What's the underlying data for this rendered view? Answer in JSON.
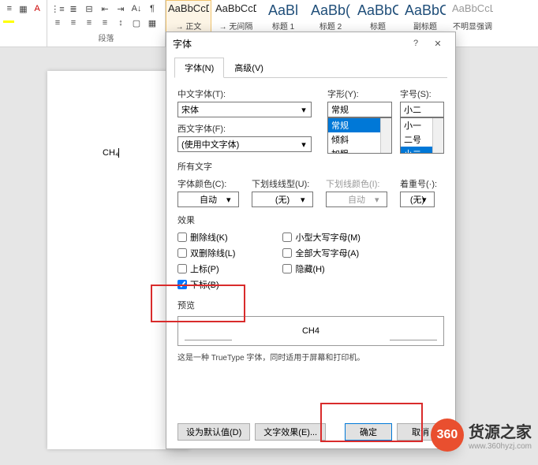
{
  "ribbon": {
    "paragraph_label": "段落",
    "styles": [
      {
        "preview": "AaBbCcDc",
        "name": "→ 正文",
        "cls": "small"
      },
      {
        "preview": "AaBbCcDc",
        "name": "→ 无间隔",
        "cls": "small"
      },
      {
        "preview": "AaBl",
        "name": "标题 1",
        "cls": "big"
      },
      {
        "preview": "AaBb(",
        "name": "标题 2",
        "cls": "big"
      },
      {
        "preview": "AaBbC",
        "name": "标题",
        "cls": "big"
      },
      {
        "preview": "AaBbC",
        "name": "副标题",
        "cls": "big"
      },
      {
        "preview": "AaBbCcL",
        "name": "不明显强调",
        "cls": "gray"
      }
    ]
  },
  "doc": {
    "text": "CH₄"
  },
  "dialog": {
    "title": "字体",
    "tabs": {
      "font": "字体(N)",
      "advanced": "高级(V)"
    },
    "cn_font_label": "中文字体(T):",
    "cn_font_value": "宋体",
    "en_font_label": "西文字体(F):",
    "en_font_value": "(使用中文字体)",
    "style_label": "字形(Y):",
    "style_value": "常规",
    "style_options": [
      "常规",
      "倾斜",
      "加粗"
    ],
    "size_label": "字号(S):",
    "size_value": "小二",
    "size_options": [
      "小一",
      "二号",
      "小二"
    ],
    "all_text": "所有文字",
    "font_color_label": "字体颜色(C):",
    "font_color_value": "自动",
    "underline_label": "下划线线型(U):",
    "underline_value": "(无)",
    "underline_color_label": "下划线颜色(I):",
    "underline_color_value": "自动",
    "emphasis_label": "着重号(·):",
    "emphasis_value": "(无)",
    "effects_label": "效果",
    "eff_strike": "删除线(K)",
    "eff_dblstrike": "双删除线(L)",
    "eff_super": "上标(P)",
    "eff_sub": "下标(B)",
    "eff_smallcaps": "小型大写字母(M)",
    "eff_allcaps": "全部大写字母(A)",
    "eff_hidden": "隐藏(H)",
    "preview_label": "预览",
    "preview_text": "CH4",
    "preview_desc": "这是一种 TrueType 字体，同时适用于屏幕和打印机。",
    "btn_default": "设为默认值(D)",
    "btn_text_effects": "文字效果(E)...",
    "btn_ok": "确定",
    "btn_cancel": "取消"
  },
  "logo": {
    "circle": "360",
    "main": "货源之家",
    "sub": "www.360hyzj.com"
  }
}
